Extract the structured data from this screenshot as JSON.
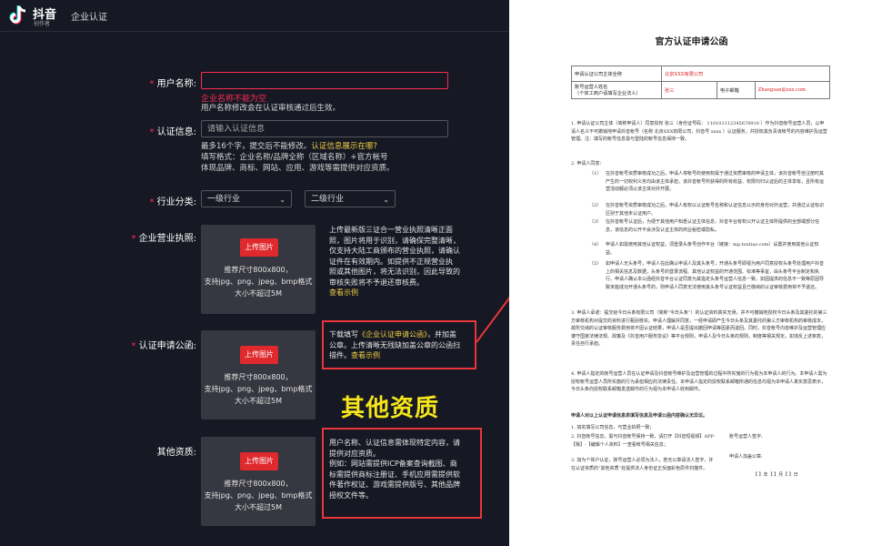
{
  "left_panel": {
    "brand": "抖音",
    "brand_sub": "创作者",
    "page_title": "企业认证",
    "username_label": "用户名称:",
    "username_value": "",
    "username_error": "企业名称不能为空",
    "username_hint": "用户名称修改会在认证审核通过后生效。",
    "verify_label": "认证信息:",
    "verify_placeholder": "请输入认证信息",
    "verify_hint1": "最多16个字，提交后不能修改。",
    "verify_hint1_link": "认证信息展示在哪?",
    "verify_hint2": "填写格式：企业名称/品牌全称（区域名称）+官方帐号",
    "verify_hint3": "体现品牌、商标、网站、应用、游戏等需提供对应资质。",
    "industry_label": "行业分类:",
    "industry_l1": "一级行业",
    "industry_l2": "二级行业",
    "license_label": "企业营业执照:",
    "upload_btn": "上传图片",
    "upload_spec1": "推荐尺寸800x800，",
    "upload_spec2": "支持jpg、png、jpeg、bmp格式",
    "upload_spec3": "大小不超过5M",
    "license_desc": [
      "上传最新版三证合一营业执照清晰正面",
      "照，图片将用于识别，请确保完整清晰，",
      "仅支持大陆工商颁布的营业执照，请确认",
      "证件在有效期内。如提供不正规营业执",
      "照或其他图片，将无法识别，因此导致的",
      "审核失败将不予退还审核费。"
    ],
    "license_example": "查看示例",
    "letter_label": "认证申请公函:",
    "letter_desc1": "下载填写",
    "letter_desc_link": "《企业认证申请公函》",
    "letter_desc2": "，并加盖",
    "letter_desc3": "公章。上传清晰无残缺加盖公章的公函扫",
    "letter_desc4": "描件。",
    "letter_example": "查看示例",
    "other_label": "其他资质:",
    "other_desc": [
      "用户名称、认证信息需体现特定内容，请",
      "提供对应资质。",
      "例如：网站需提供ICP备案查询截图、商",
      "标需提供商标注册证、手机应用需提供软",
      "件著作权证、游戏需提供版号、其他品牌",
      "授权文件等。"
    ],
    "annotation": "其他资质"
  },
  "doc": {
    "title": "官方认证申请公函",
    "row1_label": "申请认证公司主体全称",
    "row1_value": "北京XXX有限公司",
    "row2_label1": "账号运营人姓名",
    "row2_label2": "（个体工商户请填写企业法人）",
    "row2_value": "张三",
    "row2_phone_label": "电子邮箱",
    "row2_phone_value": "Zhangsan@xxx.com",
    "para1": "1.    申请认证公司主体（简称申请人）同意授权 张三（身份证号码：  110101112345678910    ）作为抖音帐号运营人员，以申请人名义不可撤销地申请抖音帐号（名称 北京XXX有限公司，抖音号 xxxx ）认证服务，并授权其负责该帐号的内容维护及运营管理。注：填写的帐号信息需与登陆的帐号信息保持一致。",
    "para2": "2.    申请人同意：",
    "items": [
      {
        "n": "（1）",
        "t": "在抖音帐号资质审核成功之后，申请人将帐号的使用权属于通过资质审核的申请主体，该抖音帐号自注册时其产生的一切权利义务均由该主体承担，该抖音帐号所获得的所有收益、权限均归认证后的主体享有，且所有运营活动都必须以该主体对外开展。"
      },
      {
        "n": "（2）",
        "t": "在抖音帐号资质审核成功之后，申请人有权以认证帐号名称和认证信息公示的身份对外运营，并通过认证标识区别于其他未认证用户。"
      },
      {
        "n": "（3）",
        "t": "在抖音帐号认证后，为便于其他用户知悉认证主体信息，抖音平台有权公开认证主体所提供的全部或部分信息，该信息的公开不会涉及认证主体的商业秘密或隐私。"
      },
      {
        "n": "（4）",
        "t": "申请人如需使用其他认证权益，须登录头条号创作平台（链接：mp.toutiao.com）设置并使用其他认证权益。"
      },
      {
        "n": "（5）",
        "t": "如申请人无头条号，申请人在此确认申请人及其头条号，开通头条号即视为用户同意授权头条号处理用户抖音上的相关信息及数据，头条号的登录流程、其他认证权益的开通范围、标准等事宜，由头条号平台制定和执行。申请人确认本公函经抖音平台认证同意为其指定头条号运营人信息一致，如因提供的信息不一致等原因导致未能成功开通头条号的，则申请人同意无法使用其头条号认证权益且已缴纳的认证审核费用将不予退还。"
      }
    ],
    "para3": "3.    申请人承诺：提交给今日头条有限公司（简称“今日头条”）的认证资料真实无误，并不可撤销地授权今日头条及其委托的第三方审核机构对提交的资料进行甄别核实。申请人理解并同意，一经申请即产生今日头条及其委托的第三方审核机构的审核成本，故所交纳的认证审核服务费用将不因认证结果，申请人是否提出撤回申请等因素而退回。同时，抖音帐号内容维护及运营管理应遵守国家法律法规、政策及《抖音用户服务协议》等平台规则，申请人及今日头条的规则，制度等相关规定。如违反上述条款，责任自行承担。",
    "para4": "4.    申请人指定的帐号运营人员在认证申请及抖音帐号维护及运营管理的过程中所实施的行为视为本申请人的行为。本申请人需为授权帐号运营人员所实施的行为承担相应的法律责任。本申请人指定的授权联系邮箱所通的信息均视为本申请人真实意思表示，今日头条向授权联系邮箱发送邮件的行为视为本申请人收到邮件。",
    "confirm_bold": "申请人对以上认证申请信息表填写信息及申请公函内容确认无异议。",
    "red1": "1. 如实填写公司信息，与营业执照一致；",
    "red2": "2. 抖音帐号信息，需与抖音帐号保持一致，请打开【抖音短视频】APP-【我】-【编辑个人资料】一查看帐号相关信息；",
    "red3": "3. 如为个体户认证，账号运营人必须为法人，若无公章请法人签字，并在认证资质的“其他资质”处提供法人身份证正反面彩色原件扫描件。",
    "sign1": "账号运营人签字:",
    "sign2": "申请人加盖公章:",
    "date": "【    】年【  】月【  】日"
  }
}
